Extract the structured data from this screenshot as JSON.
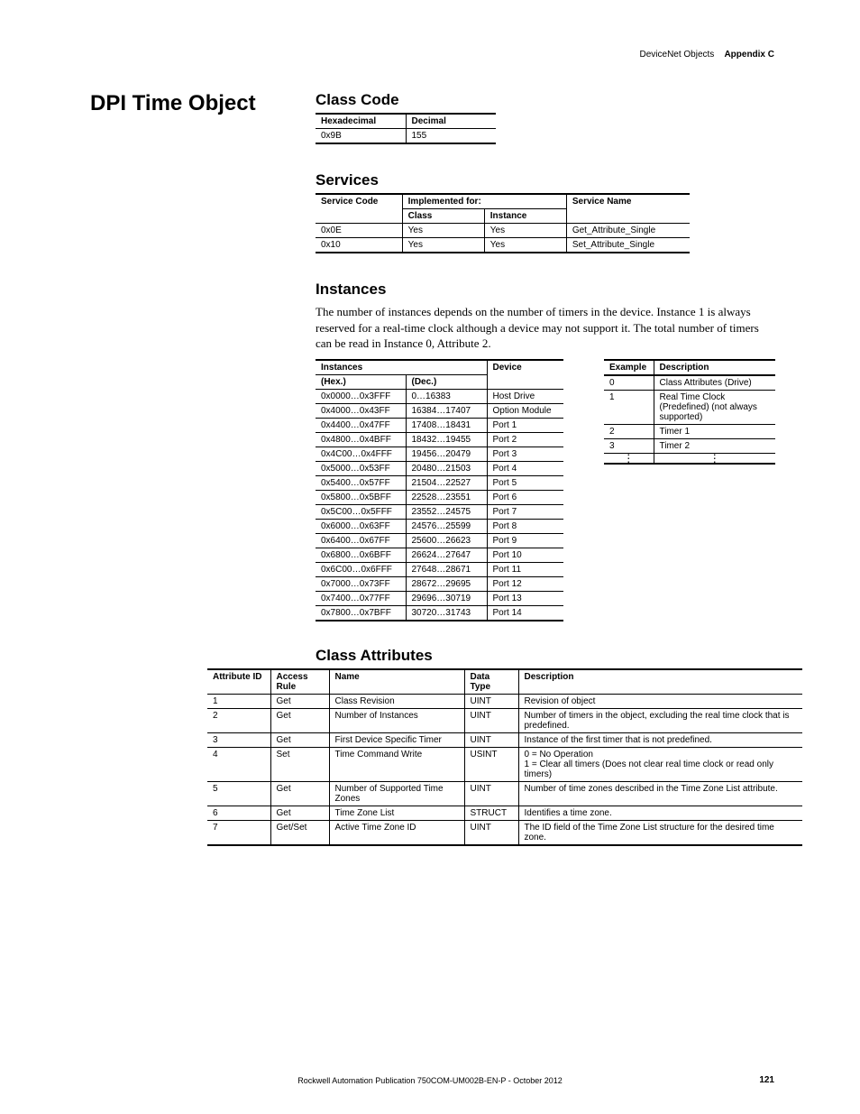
{
  "header": {
    "left": "DeviceNet Objects",
    "right": "Appendix C"
  },
  "title": "DPI Time Object",
  "class_code": {
    "heading": "Class Code",
    "cols": [
      "Hexadecimal",
      "Decimal"
    ],
    "rows": [
      [
        "0x9B",
        "155"
      ]
    ]
  },
  "services": {
    "heading": "Services",
    "head1": [
      "Service Code",
      "Implemented for:",
      "Service Name"
    ],
    "head2": [
      "Class",
      "Instance"
    ],
    "rows": [
      [
        "0x0E",
        "Yes",
        "Yes",
        "Get_Attribute_Single"
      ],
      [
        "0x10",
        "Yes",
        "Yes",
        "Set_Attribute_Single"
      ]
    ]
  },
  "instances": {
    "heading": "Instances",
    "intro": "The number of instances depends on the number of timers in the device. Instance 1 is always reserved for a real-time clock although a device may not support it. The total number of timers can be read in Instance 0, Attribute 2.",
    "left": {
      "head1": [
        "Instances",
        "Device"
      ],
      "head2": [
        "(Hex.)",
        "(Dec.)"
      ],
      "rows": [
        [
          "0x0000…0x3FFF",
          "0…16383",
          "Host Drive"
        ],
        [
          "0x4000…0x43FF",
          "16384…17407",
          "Option Module"
        ],
        [
          "0x4400…0x47FF",
          "17408…18431",
          "Port 1"
        ],
        [
          "0x4800…0x4BFF",
          "18432…19455",
          "Port 2"
        ],
        [
          "0x4C00…0x4FFF",
          "19456…20479",
          "Port 3"
        ],
        [
          "0x5000…0x53FF",
          "20480…21503",
          "Port 4"
        ],
        [
          "0x5400…0x57FF",
          "21504…22527",
          "Port 5"
        ],
        [
          "0x5800…0x5BFF",
          "22528…23551",
          "Port 6"
        ],
        [
          "0x5C00…0x5FFF",
          "23552…24575",
          "Port 7"
        ],
        [
          "0x6000…0x63FF",
          "24576…25599",
          "Port 8"
        ],
        [
          "0x6400…0x67FF",
          "25600…26623",
          "Port 9"
        ],
        [
          "0x6800…0x6BFF",
          "26624…27647",
          "Port 10"
        ],
        [
          "0x6C00…0x6FFF",
          "27648…28671",
          "Port 11"
        ],
        [
          "0x7000…0x73FF",
          "28672…29695",
          "Port 12"
        ],
        [
          "0x7400…0x77FF",
          "29696…30719",
          "Port 13"
        ],
        [
          "0x7800…0x7BFF",
          "30720…31743",
          "Port 14"
        ]
      ]
    },
    "right": {
      "head": [
        "Example",
        "Description"
      ],
      "rows": [
        [
          "0",
          "Class Attributes (Drive)"
        ],
        [
          "1",
          "Real Time Clock (Predefined) (not always supported)"
        ],
        [
          "2",
          "Timer 1"
        ],
        [
          "3",
          "Timer 2"
        ],
        [
          "⋮",
          "⋮"
        ]
      ]
    }
  },
  "class_attributes": {
    "heading": "Class Attributes",
    "head": [
      "Attribute ID",
      "Access Rule",
      "Name",
      "Data Type",
      "Description"
    ],
    "rows": [
      [
        "1",
        "Get",
        "Class Revision",
        "UINT",
        "Revision of object"
      ],
      [
        "2",
        "Get",
        "Number of Instances",
        "UINT",
        "Number of timers in the object, excluding the real time clock that is predefined."
      ],
      [
        "3",
        "Get",
        "First Device Specific Timer",
        "UINT",
        "Instance of the first timer that is not predefined."
      ],
      [
        "4",
        "Set",
        "Time Command Write",
        "USINT",
        "0 = No Operation\n1 = Clear all timers (Does not clear real time clock or read only timers)"
      ],
      [
        "5",
        "Get",
        "Number of Supported Time Zones",
        "UINT",
        "Number of time zones described in the Time Zone List attribute."
      ],
      [
        "6",
        "Get",
        "Time Zone List",
        "STRUCT",
        "Identifies a time zone."
      ],
      [
        "7",
        "Get/Set",
        "Active Time Zone ID",
        "UINT",
        "The ID field of the Time Zone List structure for the desired time zone."
      ]
    ]
  },
  "footer": "Rockwell Automation Publication 750COM-UM002B-EN-P - October 2012",
  "page_num": "121"
}
